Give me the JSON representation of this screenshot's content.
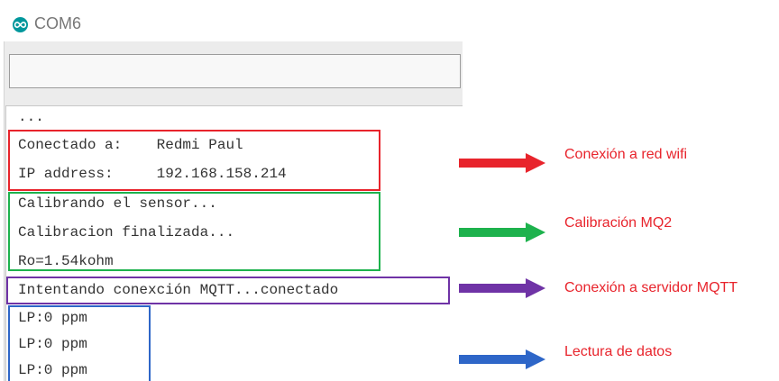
{
  "window": {
    "title": "COM6",
    "icon": "arduino-infinity-icon"
  },
  "serial_input": {
    "value": ""
  },
  "serial_output": {
    "lines": [
      "...",
      "Conectado a:    Redmi Paul",
      "IP address:     192.168.158.214",
      "Calibrando el sensor...",
      "Calibracion finalizada...",
      "Ro=1.54kohm",
      "Intentando conexción MQTT...conectado",
      "LP:0 ppm",
      "LP:0 ppm",
      "LP:0 ppm"
    ]
  },
  "annotations": [
    {
      "label": "Conexión a red wifi",
      "color": "#e8242c"
    },
    {
      "label": "Calibración MQ2",
      "color": "#1db24d"
    },
    {
      "label": "Conexión a servidor MQTT",
      "color": "#6f33a6"
    },
    {
      "label": "Lectura de datos",
      "color": "#2e66c8"
    }
  ]
}
